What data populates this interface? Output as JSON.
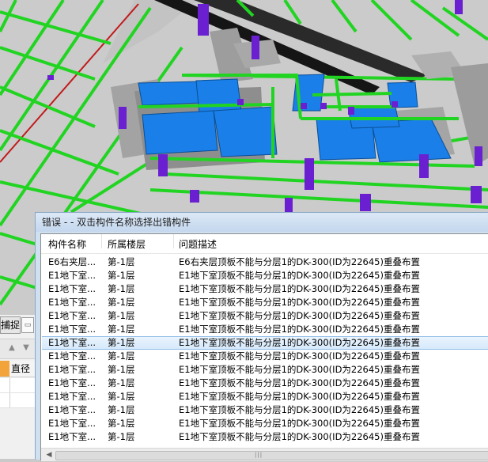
{
  "dialog": {
    "title": "错误 -  - 双击构件名称选择出错构件",
    "columns": [
      "构件名称",
      "所属楼层",
      "问题描述"
    ],
    "selected_index": 6,
    "rows": [
      {
        "name": "E6右夹层...",
        "floor": "第-1层",
        "desc": "E6右夹层顶板不能与分层1的DK-300(ID为22645)重叠布置"
      },
      {
        "name": "E1地下室...",
        "floor": "第-1层",
        "desc": "E1地下室顶板不能与分层1的DK-300(ID为22645)重叠布置"
      },
      {
        "name": "E1地下室...",
        "floor": "第-1层",
        "desc": "E1地下室顶板不能与分层1的DK-300(ID为22645)重叠布置"
      },
      {
        "name": "E1地下室...",
        "floor": "第-1层",
        "desc": "E1地下室顶板不能与分层1的DK-300(ID为22645)重叠布置"
      },
      {
        "name": "E1地下室...",
        "floor": "第-1层",
        "desc": "E1地下室顶板不能与分层1的DK-300(ID为22645)重叠布置"
      },
      {
        "name": "E1地下室...",
        "floor": "第-1层",
        "desc": "E1地下室顶板不能与分层1的DK-300(ID为22645)重叠布置"
      },
      {
        "name": "E1地下室...",
        "floor": "第-1层",
        "desc": "E1地下室顶板不能与分层1的DK-300(ID为22645)重叠布置"
      },
      {
        "name": "E1地下室...",
        "floor": "第-1层",
        "desc": "E1地下室顶板不能与分层1的DK-300(ID为22645)重叠布置"
      },
      {
        "name": "E1地下室...",
        "floor": "第-1层",
        "desc": "E1地下室顶板不能与分层1的DK-300(ID为22645)重叠布置"
      },
      {
        "name": "E1地下室...",
        "floor": "第-1层",
        "desc": "E1地下室顶板不能与分层1的DK-300(ID为22645)重叠布置"
      },
      {
        "name": "E1地下室...",
        "floor": "第-1层",
        "desc": "E1地下室顶板不能与分层1的DK-300(ID为22645)重叠布置"
      },
      {
        "name": "E1地下室...",
        "floor": "第-1层",
        "desc": "E1地下室顶板不能与分层1的DK-300(ID为22645)重叠布置"
      },
      {
        "name": "E1地下室...",
        "floor": "第-1层",
        "desc": "E1地下室顶板不能与分层1的DK-300(ID为22645)重叠布置"
      },
      {
        "name": "E1地下室...",
        "floor": "第-1层",
        "desc": "E1地下室顶板不能与分层1的DK-300(ID为22645)重叠布置"
      }
    ]
  },
  "left_panel": {
    "capture_label": "捕捉",
    "diameter_header": "直径"
  },
  "colors": {
    "slab_blue": "#1a7fe8",
    "beam_green": "#21d321",
    "column_purple": "#6a1fd1",
    "wall_gray": "#9a9a9a",
    "selection": "#d6e9fb"
  }
}
